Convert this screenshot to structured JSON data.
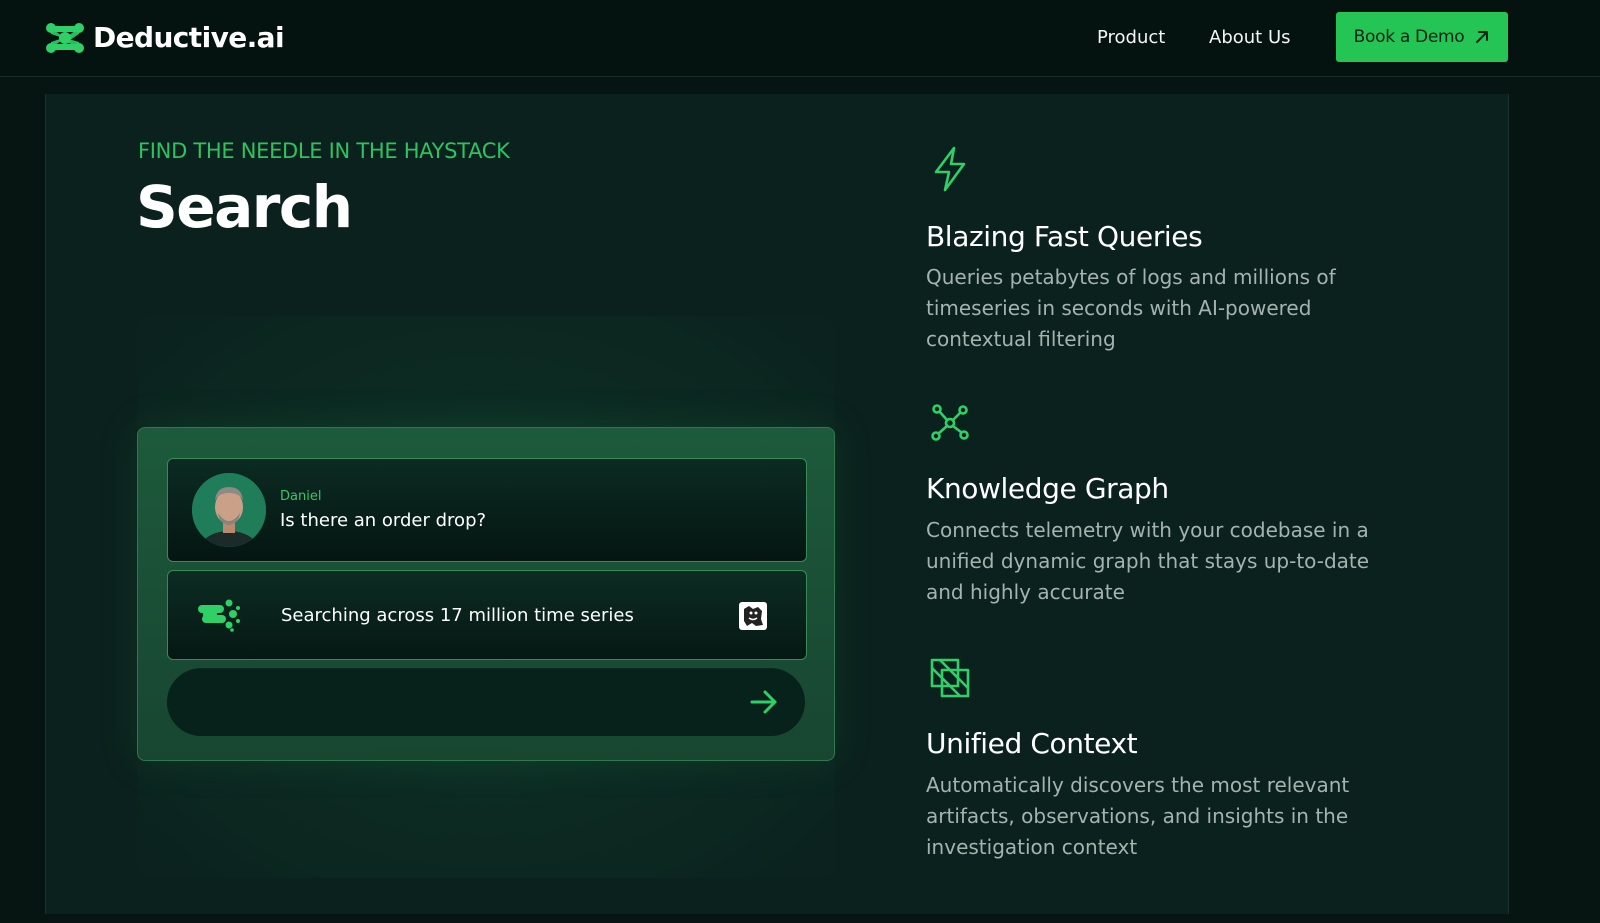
{
  "header": {
    "brand": "Deductive.ai",
    "nav": {
      "product": "Product",
      "about": "About Us"
    },
    "cta": "Book a Demo"
  },
  "hero": {
    "eyebrow": "FIND THE NEEDLE IN THE HAYSTACK",
    "title": "Search"
  },
  "demo": {
    "user_name": "Daniel",
    "user_message": "Is there an order drop?",
    "status": "Searching across 17 million time series",
    "input_value": "",
    "icons": {
      "status": "deductive-logo-icon",
      "source": "datadog-icon",
      "send": "arrow-right-icon"
    }
  },
  "features": [
    {
      "icon": "lightning-icon",
      "title": "Blazing Fast Queries",
      "desc": "Queries petabytes of logs and millions of timeseries in seconds with AI-powered contextual filtering"
    },
    {
      "icon": "graph-icon",
      "title": "Knowledge Graph",
      "desc": "Connects telemetry with your codebase in a unified dynamic graph that stays up-to-date and highly accurate"
    },
    {
      "icon": "layers-icon",
      "title": "Unified Context",
      "desc": "Automatically discovers the most relevant artifacts, observations, and insights in the investigation context"
    }
  ],
  "colors": {
    "accent": "#24c455",
    "background": "#0b211d",
    "header": "#051310"
  }
}
